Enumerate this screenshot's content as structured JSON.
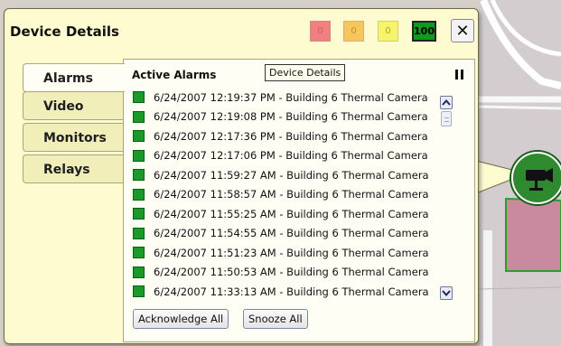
{
  "panel": {
    "title": "Device Details",
    "severity_counts": [
      {
        "color": "#f08080",
        "value": "0"
      },
      {
        "color": "#f8c45c",
        "value": "0"
      },
      {
        "color": "#f7f36a",
        "value": "0"
      },
      {
        "color": "#0f9a1f",
        "value": "100"
      }
    ],
    "close_label": "✕"
  },
  "tabs": [
    "Alarms",
    "Video",
    "Monitors",
    "Relays"
  ],
  "alarms": {
    "title": "Active Alarms",
    "tooltip": "Device Details",
    "items": [
      "6/24/2007 12:19:37 PM - Building 6 Thermal Camera",
      "6/24/2007 12:19:08 PM - Building 6 Thermal Camera",
      "6/24/2007 12:17:36 PM - Building 6 Thermal Camera",
      "6/24/2007 12:17:06 PM - Building 6 Thermal Camera",
      "6/24/2007 11:59:27 AM - Building 6 Thermal Camera",
      "6/24/2007 11:58:57 AM - Building 6 Thermal Camera",
      "6/24/2007 11:55:25 AM - Building 6 Thermal Camera",
      "6/24/2007 11:54:55 AM - Building 6 Thermal Camera",
      "6/24/2007 11:51:23 AM - Building 6 Thermal Camera",
      "6/24/2007 11:50:53 AM - Building 6 Thermal Camera",
      "6/24/2007 11:33:13 AM - Building 6 Thermal Camera"
    ],
    "acknowledge_label": "Acknowledge All",
    "snooze_label": "Snooze All"
  },
  "colors": {
    "panel_bg": "#fffbd0",
    "alarm_status": "#1a9a28",
    "device_icon": "#2f8a2f"
  },
  "icons": {
    "pause": "pause-icon",
    "close": "close-icon",
    "device": "camera-icon",
    "scroll_up": "chevron-up-icon",
    "scroll_down": "chevron-down-icon"
  }
}
